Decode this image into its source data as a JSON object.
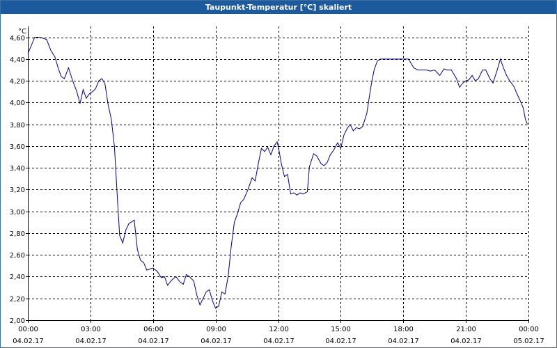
{
  "window": {
    "title": "Taupunkt-Temperatur [°C] skaliert"
  },
  "colors": {
    "titlebar": "#1c5aa0",
    "line": "#00008b",
    "grid": "#000000"
  },
  "chart_data": {
    "type": "line",
    "title": "Taupunkt-Temperatur [°C] skaliert",
    "unit": "°C",
    "ylim": [
      2.0,
      4.7
    ],
    "yticks": [
      2.0,
      2.2,
      2.4,
      2.6,
      2.8,
      3.0,
      3.2,
      3.4,
      3.6,
      3.8,
      4.0,
      4.2,
      4.4,
      4.6
    ],
    "ytick_labels": [
      "2,00",
      "2,20",
      "2,40",
      "2,60",
      "2,80",
      "3,00",
      "3,20",
      "3,40",
      "3,60",
      "3,80",
      "4,00",
      "4,20",
      "4,40",
      "4,60"
    ],
    "xlim_hours": [
      0,
      24
    ],
    "xticks_hours": [
      0,
      3,
      6,
      9,
      12,
      15,
      18,
      21,
      24
    ],
    "xtick_time_labels": [
      "00:00",
      "03:00",
      "06:00",
      "09:00",
      "12:00",
      "15:00",
      "18:00",
      "21:00",
      "00:00"
    ],
    "xtick_date_labels": [
      "04.02.17",
      "04.02.17",
      "04.02.17",
      "04.02.17",
      "04.02.17",
      "04.02.17",
      "04.02.17",
      "04.02.17",
      "05.02.17"
    ],
    "grid": true,
    "series": [
      {
        "x_hours": [
          0,
          0.33,
          0.6,
          0.9,
          1.1,
          1.3,
          1.45,
          1.6,
          1.75,
          1.95,
          2.15,
          2.35,
          2.5,
          2.65,
          2.8,
          2.9,
          3.0,
          3.1,
          3.25,
          3.4,
          3.55,
          3.7,
          3.85,
          4.0,
          4.15,
          4.3,
          4.4,
          4.55,
          4.7,
          4.85,
          4.95,
          5.1,
          5.25,
          5.4,
          5.55,
          5.7,
          5.85,
          6.0,
          6.2,
          6.4,
          6.55,
          6.7,
          6.9,
          7.1,
          7.3,
          7.45,
          7.6,
          7.75,
          7.95,
          8.1,
          8.25,
          8.4,
          8.55,
          8.7,
          8.85,
          9.0,
          9.15,
          9.3,
          9.45,
          9.6,
          9.75,
          9.9,
          10.05,
          10.2,
          10.35,
          10.55,
          10.75,
          10.9,
          11.05,
          11.2,
          11.35,
          11.5,
          11.65,
          11.8,
          11.95,
          12.05,
          12.15,
          12.3,
          12.45,
          12.6,
          12.75,
          12.9,
          13.05,
          13.2,
          13.4,
          13.5,
          13.7,
          13.85,
          14.05,
          14.2,
          14.35,
          14.5,
          14.65,
          14.85,
          15.0,
          15.15,
          15.3,
          15.45,
          15.6,
          15.75,
          15.9,
          16.05,
          16.25,
          16.45,
          16.6,
          16.75,
          16.9,
          17.05,
          17.2,
          17.35,
          17.55,
          17.75,
          18.0,
          18.25,
          18.5,
          18.7,
          18.9,
          19.1,
          19.3,
          19.5,
          19.75,
          19.95,
          20.1,
          20.3,
          20.55,
          20.7,
          20.85,
          21.0,
          21.15,
          21.3,
          21.45,
          21.6,
          21.8,
          21.95,
          22.15,
          22.3,
          22.5,
          22.65,
          22.8,
          22.95,
          23.1,
          23.3,
          23.45,
          23.6,
          23.75,
          23.85,
          23.95,
          24.0
        ],
        "values": [
          4.45,
          4.6,
          4.6,
          4.58,
          4.48,
          4.42,
          4.32,
          4.24,
          4.22,
          4.32,
          4.2,
          4.1,
          3.99,
          4.12,
          4.04,
          4.07,
          4.09,
          4.1,
          4.13,
          4.2,
          4.22,
          4.17,
          3.98,
          3.85,
          3.6,
          3.1,
          2.78,
          2.71,
          2.83,
          2.89,
          2.9,
          2.92,
          2.65,
          2.55,
          2.53,
          2.46,
          2.47,
          2.48,
          2.45,
          2.39,
          2.4,
          2.32,
          2.37,
          2.4,
          2.35,
          2.33,
          2.42,
          2.4,
          2.36,
          2.23,
          2.14,
          2.2,
          2.26,
          2.28,
          2.18,
          2.11,
          2.13,
          2.26,
          2.24,
          2.4,
          2.68,
          2.9,
          2.98,
          3.08,
          3.11,
          3.2,
          3.31,
          3.28,
          3.44,
          3.58,
          3.55,
          3.59,
          3.52,
          3.6,
          3.64,
          3.55,
          3.44,
          3.32,
          3.34,
          3.16,
          3.17,
          3.15,
          3.17,
          3.16,
          3.18,
          3.41,
          3.53,
          3.51,
          3.44,
          3.42,
          3.45,
          3.52,
          3.56,
          3.63,
          3.58,
          3.7,
          3.76,
          3.8,
          3.74,
          3.77,
          3.76,
          3.78,
          3.9,
          4.15,
          4.3,
          4.38,
          4.4,
          4.4,
          4.4,
          4.4,
          4.4,
          4.4,
          4.4,
          4.4,
          4.32,
          4.3,
          4.3,
          4.3,
          4.29,
          4.3,
          4.25,
          4.31,
          4.3,
          4.3,
          4.22,
          4.14,
          4.18,
          4.2,
          4.21,
          4.25,
          4.2,
          4.22,
          4.3,
          4.3,
          4.22,
          4.18,
          4.3,
          4.4,
          4.32,
          4.25,
          4.2,
          4.15,
          4.08,
          4.02,
          3.95,
          3.85,
          3.8
        ]
      }
    ]
  }
}
